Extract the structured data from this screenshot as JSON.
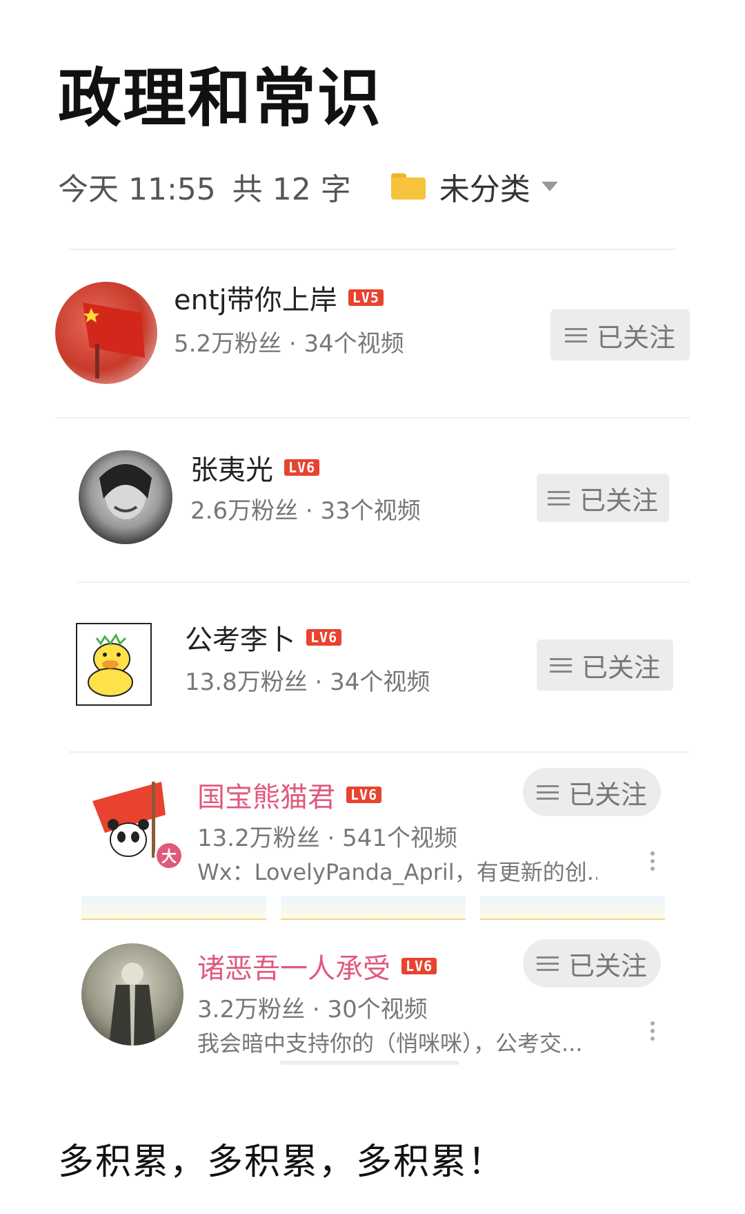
{
  "note": {
    "title": "政理和常识",
    "time": "今天 11:55",
    "word_count": "共 12 字",
    "category": "未分类",
    "folder_icon": "folder-icon",
    "footer": "多积累，多积累，多积累！"
  },
  "accounts": [
    {
      "name": "entj带你上岸",
      "level": "LV5",
      "stats": "5.2万粉丝 · 34个视频",
      "follow_label": "已关注"
    },
    {
      "name": "张夷光",
      "level": "LV6",
      "stats": "2.6万粉丝 · 33个视频",
      "follow_label": "已关注"
    },
    {
      "name": "公考李卜",
      "level": "LV6",
      "stats": "13.8万粉丝 · 34个视频",
      "follow_label": "已关注"
    },
    {
      "name": "国宝熊猫君",
      "level": "LV6",
      "stats": "13.2万粉丝 · 541个视频",
      "desc": "Wx：LovelyPanda_April，有更新的创...",
      "badge": "大",
      "follow_label": "已关注"
    },
    {
      "name": "诸恶吾一人承受",
      "level": "LV6",
      "stats": "3.2万粉丝 · 30个视频",
      "desc": "我会暗中支持你的（悄咪咪），公考交...",
      "follow_label": "已关注"
    }
  ],
  "colors": {
    "accent_pink": "#e0597d",
    "level_badge": "#e8432f",
    "folder": "#f6c33a",
    "follow_bg": "#ececec"
  }
}
